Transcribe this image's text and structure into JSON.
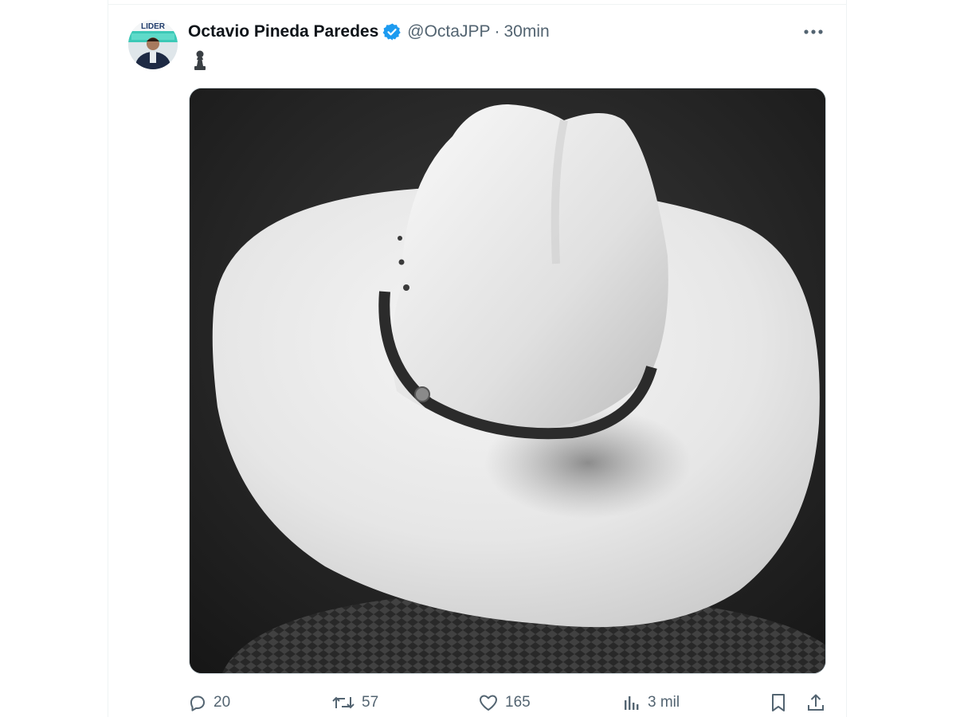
{
  "tweet": {
    "display_name": "Octavio Pineda Paredes",
    "handle": "@OctaJPP",
    "separator": "·",
    "time": "30min",
    "text_icon": "pawn-icon",
    "avatar_banner_text": "LIDER"
  },
  "colors": {
    "verified_blue": "#1d9bf0",
    "secondary_text": "#536471",
    "primary_text": "#0f1419"
  },
  "actions": {
    "reply_count": "20",
    "retweet_count": "57",
    "like_count": "165",
    "views_count": "3 mil"
  }
}
